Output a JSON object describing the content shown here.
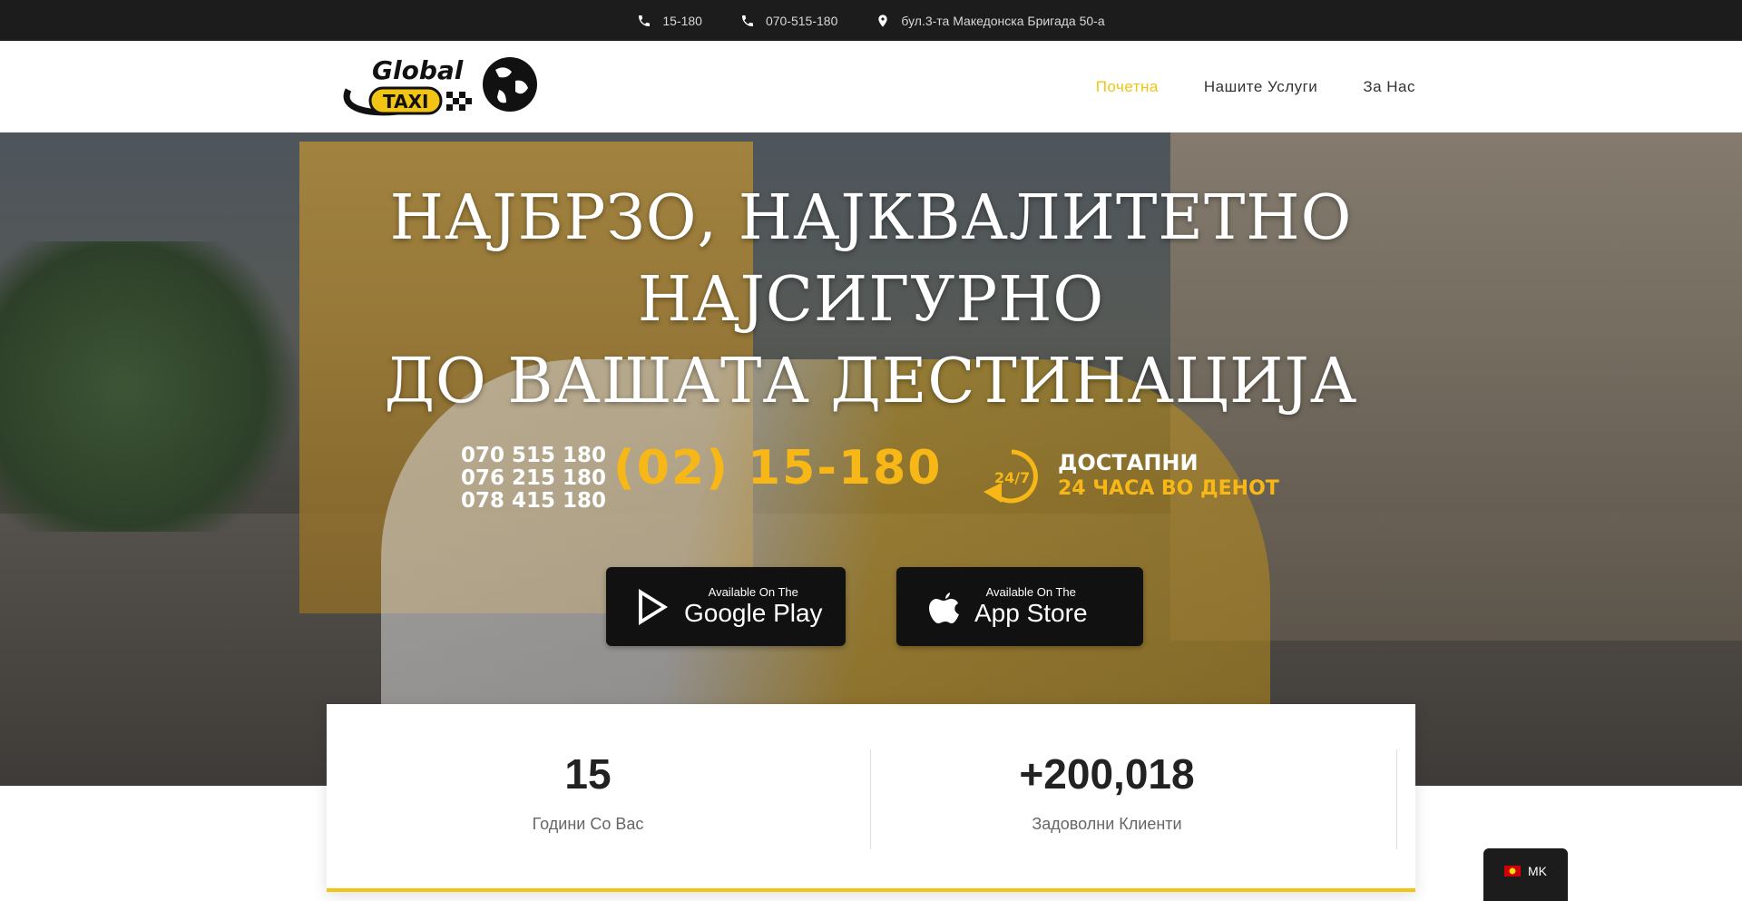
{
  "topbar": {
    "phone_short": "15-180",
    "phone_mobile": "070-515-180",
    "address": "бул.3-та Македонска Бригада 50-а"
  },
  "header": {
    "logo_text_top": "Global",
    "logo_text_badge": "TAXI",
    "nav": [
      {
        "label": "Почетна",
        "active": true
      },
      {
        "label": "Нашите Услуги",
        "active": false
      },
      {
        "label": "За Нас",
        "active": false
      }
    ]
  },
  "hero": {
    "title_line1": "НАЈБРЗО, НАЈКВАЛИТЕТНО",
    "title_line2": "НАЈСИГУРНО",
    "title_line3": "ДО ВАШАТА ДЕСТИНАЦИЈА",
    "phones": [
      "070 515 180",
      "076 215 180",
      "078 415 180"
    ],
    "main_phone": "(02) 15-180",
    "badge": "24/7",
    "availability_line1": "ДОСТАПНИ",
    "availability_line2": "24 ЧАСА ВО ДЕНОТ",
    "google_play": {
      "small": "Available On The",
      "big": "Google Play"
    },
    "app_store": {
      "small": "Available On The",
      "big": "App Store"
    }
  },
  "stats": [
    {
      "value": "15",
      "label": "Години Со Вас"
    },
    {
      "value": "+200,018",
      "label": "Задоволни Клиенти"
    }
  ],
  "language": {
    "code": "MK"
  },
  "colors": {
    "accent": "#f2c414",
    "dark": "#1c1c1c"
  }
}
